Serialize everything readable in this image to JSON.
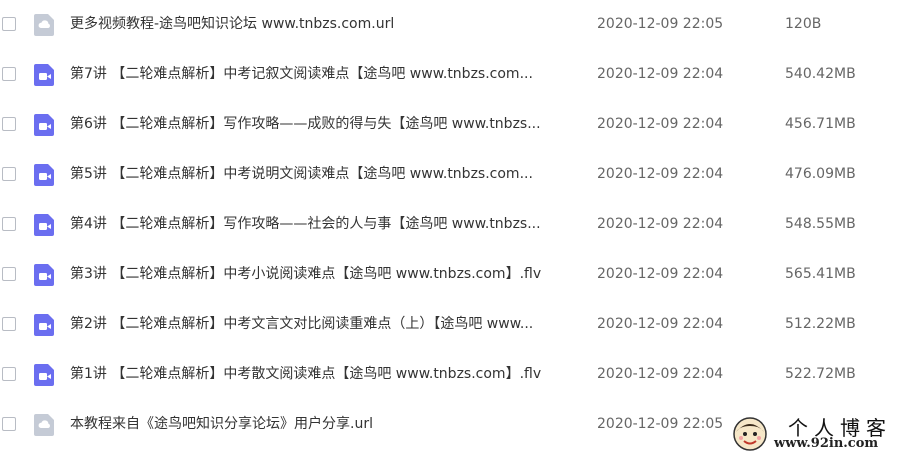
{
  "files": [
    {
      "name": "更多视频教程-途鸟吧知识论坛 www.tnbzs.com.url",
      "date": "2020-12-09 22:05",
      "size": "120B",
      "icon": "cloud-link-icon"
    },
    {
      "name": "第7讲 【二轮难点解析】中考记叙文阅读难点【途鸟吧 www.tnbzs.com...",
      "date": "2020-12-09 22:04",
      "size": "540.42MB",
      "icon": "video-file-icon"
    },
    {
      "name": "第6讲 【二轮难点解析】写作攻略——成败的得与失【途鸟吧 www.tnbzs...",
      "date": "2020-12-09 22:04",
      "size": "456.71MB",
      "icon": "video-file-icon"
    },
    {
      "name": "第5讲 【二轮难点解析】中考说明文阅读难点【途鸟吧 www.tnbzs.com...",
      "date": "2020-12-09 22:04",
      "size": "476.09MB",
      "icon": "video-file-icon"
    },
    {
      "name": "第4讲 【二轮难点解析】写作攻略——社会的人与事【途鸟吧 www.tnbzs...",
      "date": "2020-12-09 22:04",
      "size": "548.55MB",
      "icon": "video-file-icon"
    },
    {
      "name": "第3讲 【二轮难点解析】中考小说阅读难点【途鸟吧 www.tnbzs.com】.flv",
      "date": "2020-12-09 22:04",
      "size": "565.41MB",
      "icon": "video-file-icon"
    },
    {
      "name": "第2讲 【二轮难点解析】中考文言文对比阅读重难点（上）【途鸟吧 www...",
      "date": "2020-12-09 22:04",
      "size": "512.22MB",
      "icon": "video-file-icon"
    },
    {
      "name": "第1讲 【二轮难点解析】中考散文阅读难点【途鸟吧 www.tnbzs.com】.flv",
      "date": "2020-12-09 22:04",
      "size": "522.72MB",
      "icon": "video-file-icon"
    },
    {
      "name": "本教程来自《途鸟吧知识分享论坛》用户分享.url",
      "date": "2020-12-09 22:05",
      "size": "",
      "icon": "cloud-link-icon"
    }
  ],
  "watermark": {
    "title": "个人博客",
    "url": "www.92in.com"
  },
  "colors": {
    "video_icon": "#6b6ef0",
    "link_icon": "#c5cbd6"
  }
}
